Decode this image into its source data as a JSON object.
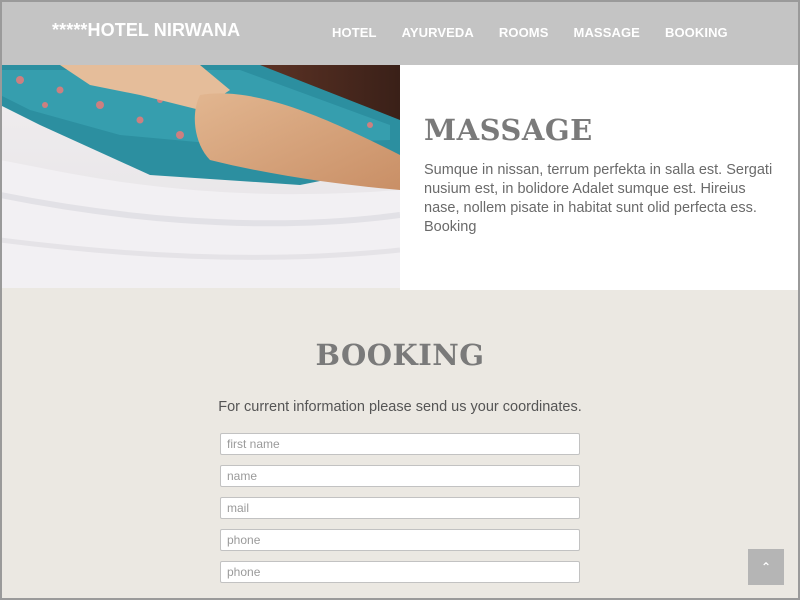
{
  "header": {
    "logo": "*****HOTEL NIRWANA",
    "nav": [
      "HOTEL",
      "AYURVEDA",
      "ROOMS",
      "MASSAGE",
      "BOOKING"
    ]
  },
  "hero": {
    "image_alt": "massage photo",
    "title": "MASSAGE",
    "body": "Sumque in nissan, terrum perfekta in salla est. Sergati nusium est, in bolidore Adalet sumque est. Hireius nase, nollem pisate in habitat sunt olid perfecta ess. Booking"
  },
  "booking": {
    "title": "BOOKING",
    "subtitle": "For current information please send us your coordinates.",
    "fields": [
      {
        "placeholder": "first name"
      },
      {
        "placeholder": "name"
      },
      {
        "placeholder": "mail"
      },
      {
        "placeholder": "phone"
      },
      {
        "placeholder": "phone"
      }
    ]
  },
  "back_to_top": {
    "icon": "chevron-up-icon",
    "glyph": "⌃"
  },
  "colors": {
    "header_bg": "#c4c4c4",
    "booking_bg": "#ebe8e2",
    "heading": "#7a7a7a",
    "body_text": "#6a6a6a"
  }
}
